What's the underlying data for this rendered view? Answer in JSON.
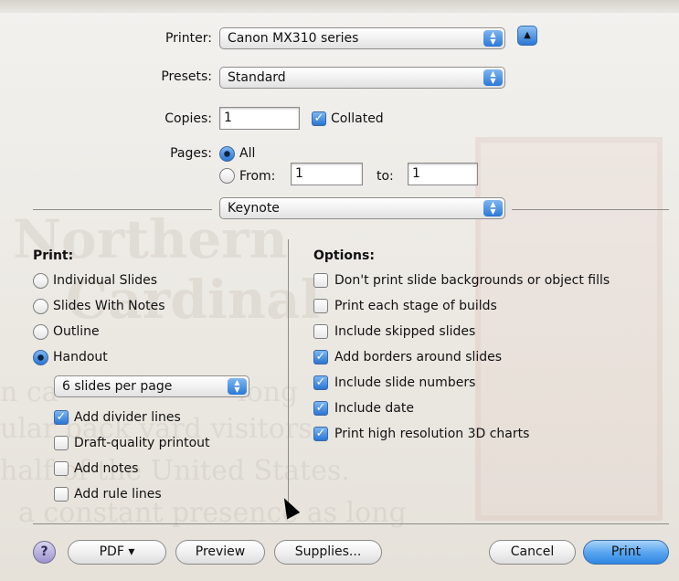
{
  "background_slide": {
    "lines": [
      "Northern",
      "Cardinal",
      "n ca",
      "long",
      "ular back yard visitors",
      "half of the United States.",
      "a constant presence as long"
    ]
  },
  "printer": {
    "label": "Printer:",
    "value": "Canon MX310 series"
  },
  "presets": {
    "label": "Presets:",
    "value": "Standard"
  },
  "copies": {
    "label": "Copies:",
    "value": "1",
    "collated_label": "Collated",
    "collated": true
  },
  "pages": {
    "label": "Pages:",
    "all_label": "All",
    "from_label": "From:",
    "from_value": "1",
    "to_label": "to:",
    "to_value": "1",
    "selected": "all"
  },
  "app_popup": {
    "value": "Keynote"
  },
  "print_section": {
    "title": "Print:",
    "options": [
      {
        "label": "Individual Slides",
        "selected": false
      },
      {
        "label": "Slides With Notes",
        "selected": false
      },
      {
        "label": "Outline",
        "selected": false
      },
      {
        "label": "Handout",
        "selected": true
      }
    ],
    "per_page": "6 slides per page",
    "checkboxes": [
      {
        "label": "Add divider lines",
        "checked": true
      },
      {
        "label": "Draft-quality printout",
        "checked": false
      },
      {
        "label": "Add notes",
        "checked": false
      },
      {
        "label": "Add rule lines",
        "checked": false
      }
    ]
  },
  "options_section": {
    "title": "Options:",
    "checkboxes": [
      {
        "label": "Don't print slide backgrounds or object fills",
        "checked": false
      },
      {
        "label": "Print each stage of builds",
        "checked": false
      },
      {
        "label": "Include skipped slides",
        "checked": false
      },
      {
        "label": "Add borders around slides",
        "checked": true
      },
      {
        "label": "Include slide numbers",
        "checked": true
      },
      {
        "label": "Include date",
        "checked": true
      },
      {
        "label": "Print high resolution 3D charts",
        "checked": true
      }
    ]
  },
  "buttons": {
    "help": "?",
    "pdf": "PDF ▾",
    "preview": "Preview",
    "supplies": "Supplies...",
    "cancel": "Cancel",
    "print": "Print"
  },
  "colors": {
    "accent": "#2f86e3",
    "sheet": "#ebe8e2"
  }
}
